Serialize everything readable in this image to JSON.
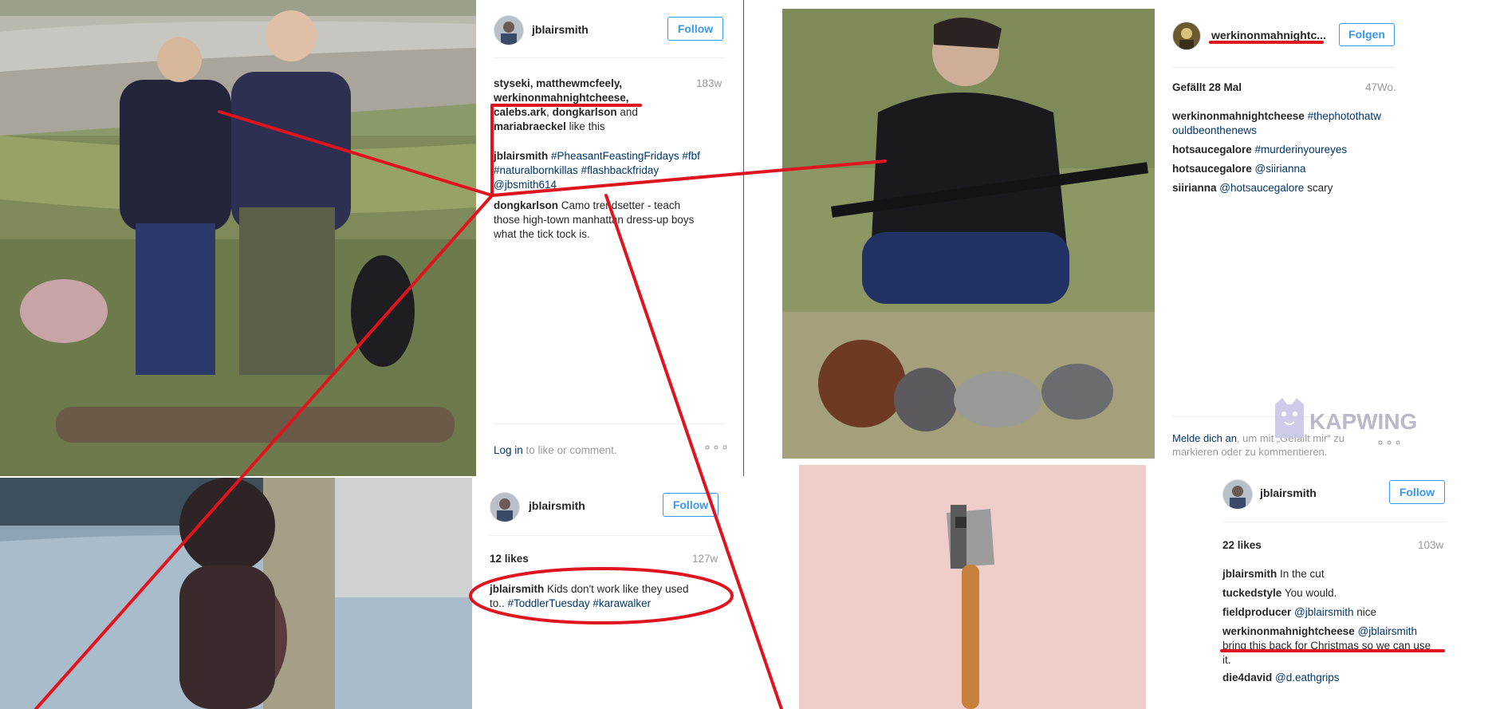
{
  "post1": {
    "username": "jblairsmith",
    "follow_label": "Follow",
    "likers_line1": "styseki, matthewmcfeely,",
    "likers_line2": "werkinonmahnightcheese,",
    "likers_line3a": "calebs.ark",
    "likers_line3b": ", ",
    "likers_line3c": "dongkarlson",
    "likers_line3d": " and",
    "likers_line4a": "mariabraeckel",
    "likers_line4b": " like this",
    "age": "183w",
    "caption_user": "jblairsmith",
    "caption_line1": "#PheasantFeastingFridays #fbf",
    "caption_line2": "#naturalbornkillas #flashbackfriday",
    "caption_line3": "@jbsmith614",
    "comment_user": "dongkarlson",
    "comment_line1": "Camo trendsetter - teach",
    "comment_line2": "those high-town manhattan dress-up boys",
    "comment_line3": "what the tick tock is.",
    "login_link": "Log in",
    "login_rest": " to like or comment.",
    "more": "∘∘∘"
  },
  "post2": {
    "username": "werkinonmahnightc...",
    "follow_label": "Folgen",
    "likes": "Gefällt 28 Mal",
    "age": "47Wo.",
    "c1_user": "werkinonmahnightcheese",
    "c1_line1": "#thephotothatw",
    "c1_line2": "ouldbeonthenews",
    "c2_user": "hotsaucegalore",
    "c2_text": "#murderinyoureyes",
    "c3_user": "hotsaucegalore",
    "c3_text": "@siirianna",
    "c4_user": "siirianna",
    "c4_tag": "@hotsaucegalore",
    "c4_rest": " scary",
    "login_link": "Melde dich an",
    "login_rest1": ", um mit „Gefällt mir“ zu",
    "login_rest2": "markieren oder zu kommentieren.",
    "more": "∘∘∘"
  },
  "post3": {
    "username": "jblairsmith",
    "follow_label": "Follow",
    "likes": "12 likes",
    "age": "127w",
    "caption_user": "jblairsmith",
    "caption_line1": "Kids don't work like they used",
    "caption_line2a": "to.. ",
    "caption_line2b": "#ToddlerTuesday #karawalker"
  },
  "post4": {
    "username": "jblairsmith",
    "follow_label": "Follow",
    "likes": "22 likes",
    "age": "103w",
    "c1_user": "jblairsmith",
    "c1_text": "In the cut",
    "c2_user": "tuckedstyle",
    "c2_text": "You would.",
    "c3_user": "fieldproducer",
    "c3_tag": "@jblairsmith",
    "c3_rest": " nice",
    "c4_user": "werkinonmahnightcheese",
    "c4_tag": "@jblairsmith",
    "c4_line2": "bring this back for Christmas so we can use",
    "c4_line3": "it.",
    "c5_user": "die4david",
    "c5_tag": "@d.eathgrips"
  },
  "watermark": {
    "text": "KAPWING",
    "icon": "kapwing-cat-logo-icon",
    "color": "#b9b9c9"
  },
  "colors": {
    "annotation_red": "#e0141e",
    "link_blue": "#003569",
    "follow_blue": "#3897f0"
  }
}
